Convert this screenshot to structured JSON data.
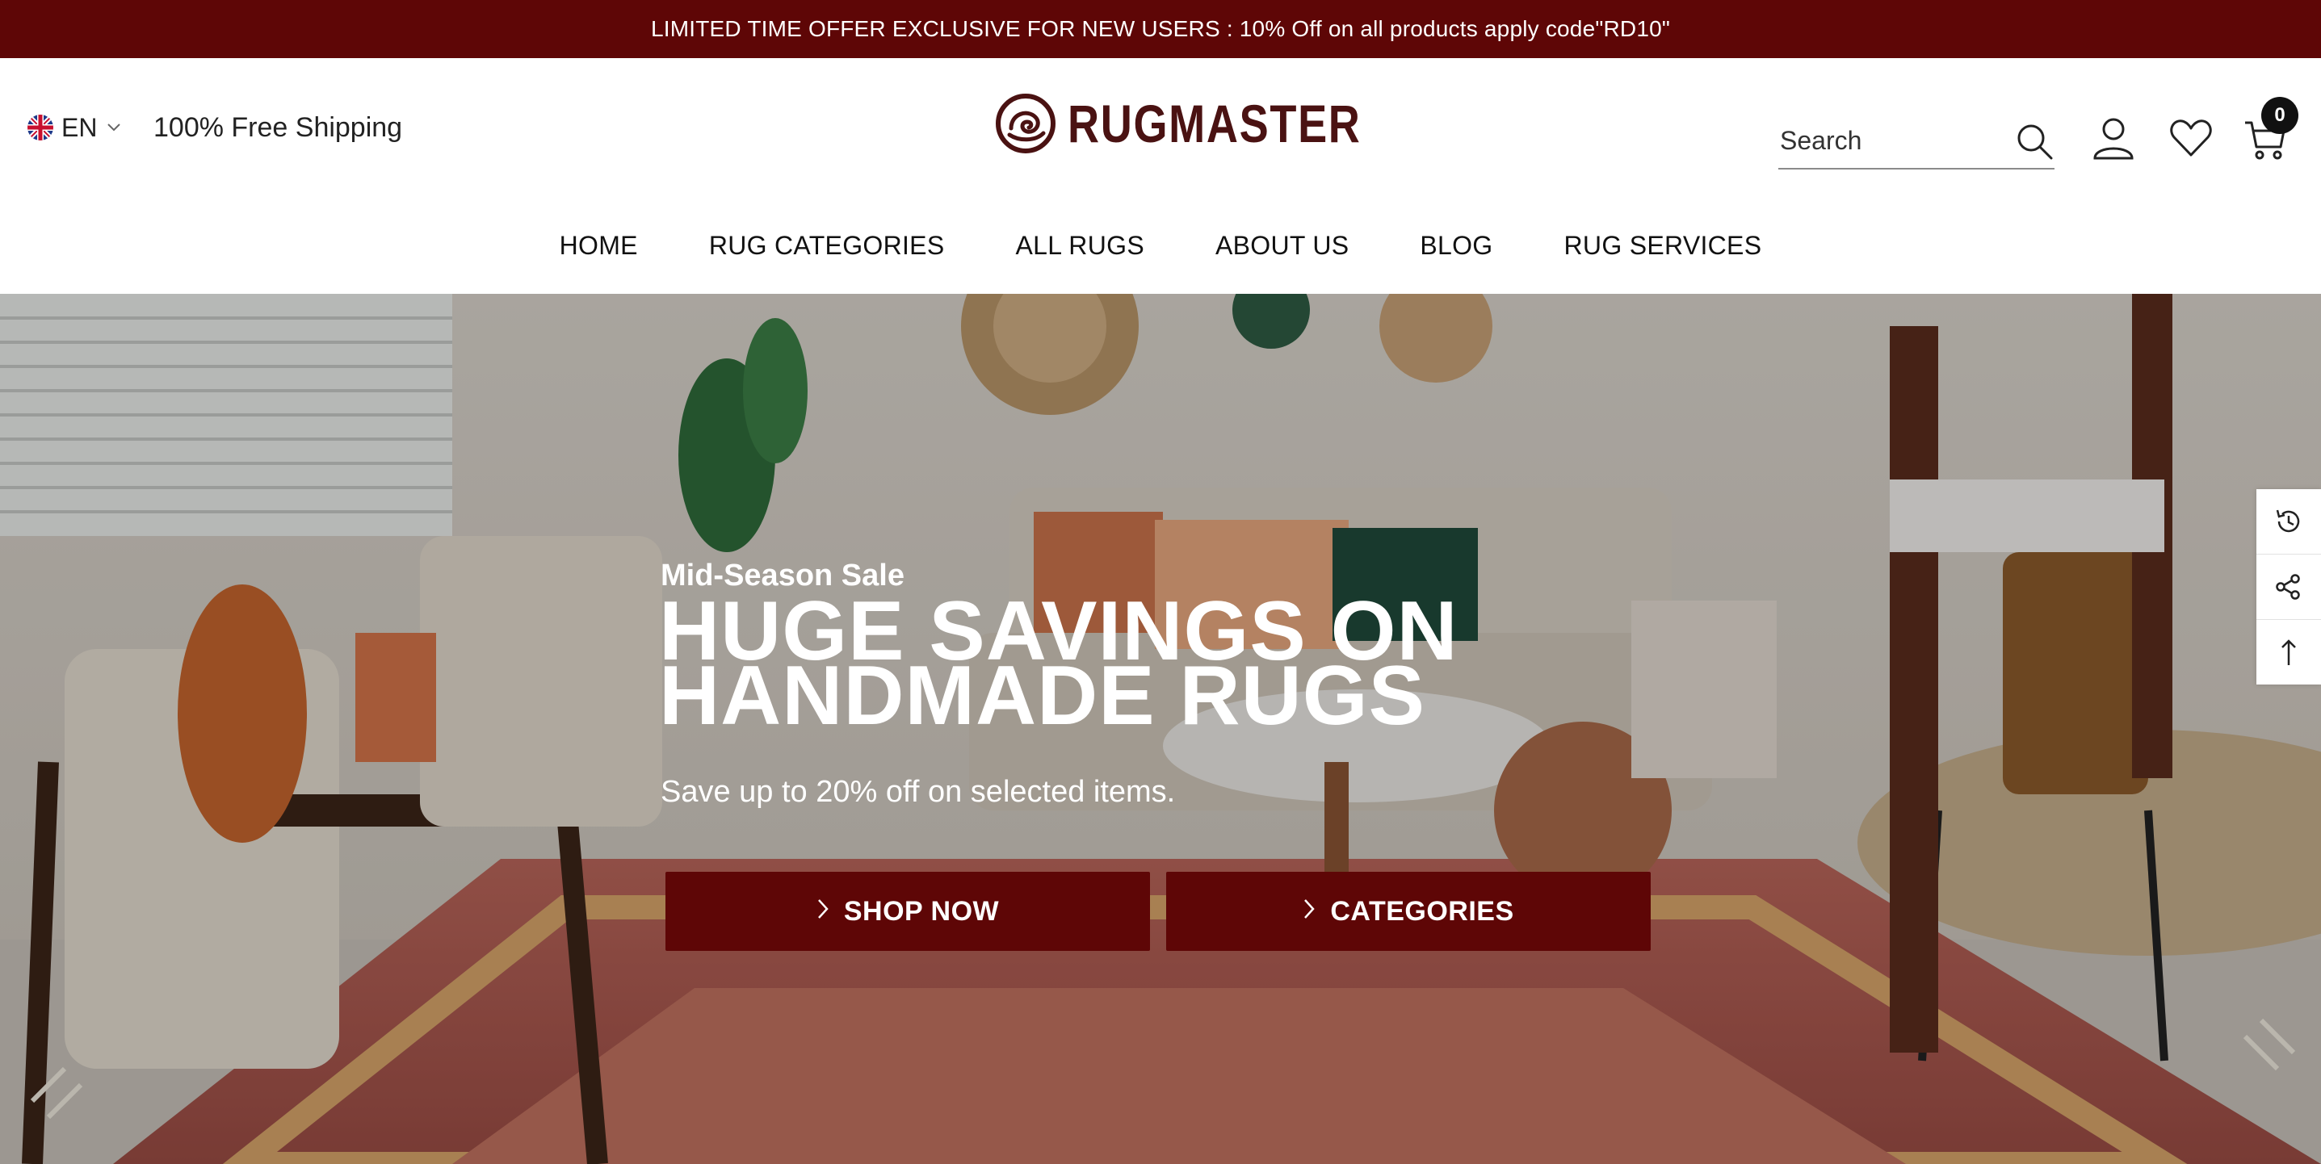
{
  "announcement": "LIMITED TIME OFFER EXCLUSIVE FOR NEW USERS : 10% Off on all products apply code\"RD10\"",
  "header": {
    "language": "EN",
    "shipping": "100% Free Shipping",
    "brand": "RUGMASTER",
    "search_placeholder": "Search",
    "cart_count": "0"
  },
  "nav": [
    {
      "label": "HOME"
    },
    {
      "label": "RUG CATEGORIES"
    },
    {
      "label": "ALL RUGS"
    },
    {
      "label": "ABOUT US"
    },
    {
      "label": "BLOG"
    },
    {
      "label": "RUG SERVICES"
    }
  ],
  "hero": {
    "eyebrow": "Mid-Season Sale",
    "title_line1": "HUGE SAVINGS ON",
    "title_line2": "HANDMADE RUGS",
    "subtitle": "Save up to 20% off on selected items.",
    "primary_button": "SHOP NOW",
    "secondary_button": "CATEGORIES"
  },
  "side_tools": [
    "history-icon",
    "share-icon",
    "arrow-up-icon"
  ],
  "colors": {
    "brand": "#5e0606",
    "logo": "#4a1212"
  }
}
